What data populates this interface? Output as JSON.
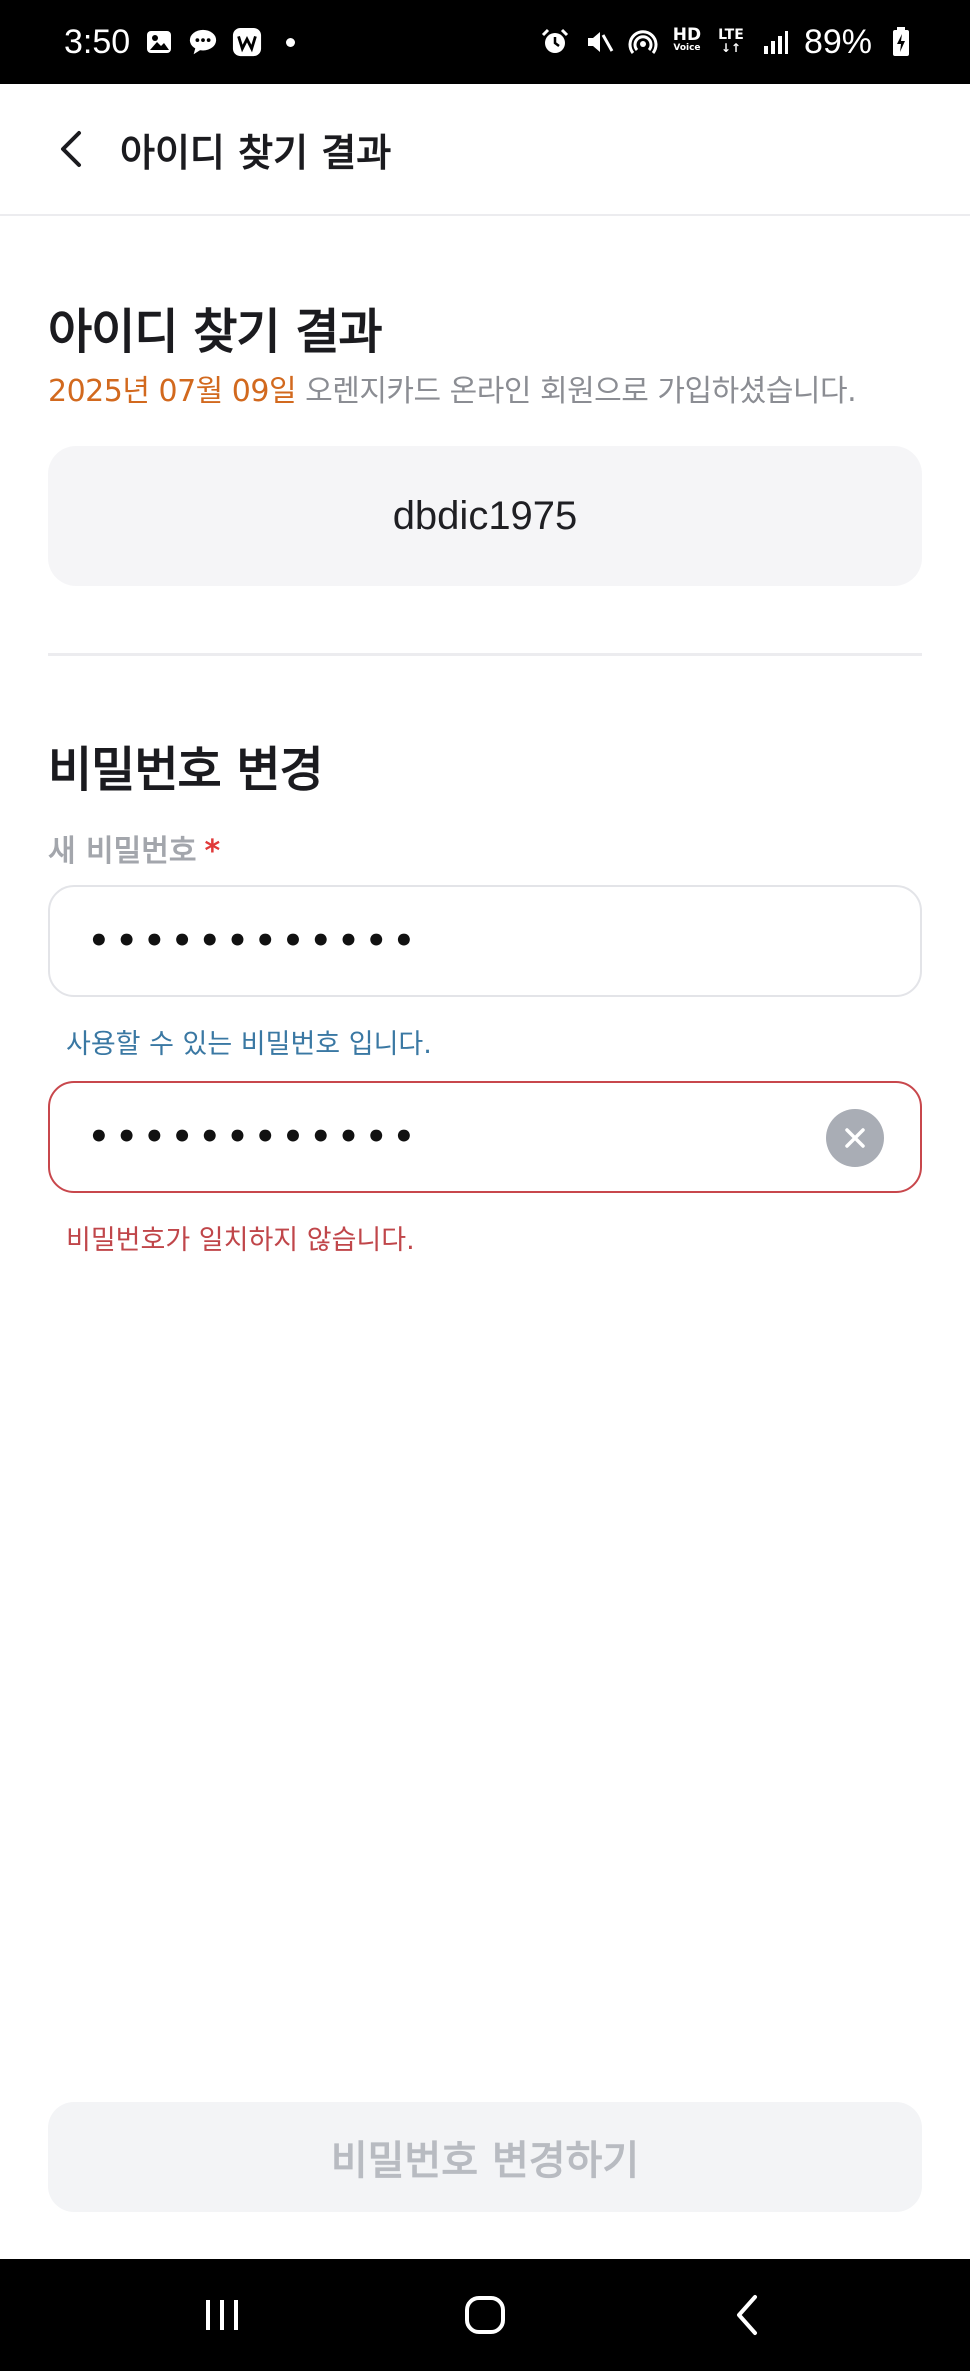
{
  "status_bar": {
    "time": "3:50",
    "battery": "89%",
    "hd_label": "HD",
    "voice_label": "Voice",
    "lte_label": "LTE"
  },
  "app_bar": {
    "title": "아이디 찾기 결과"
  },
  "find_id": {
    "heading": "아이디 찾기 결과",
    "join_date": "2025년 07월 09일",
    "join_message": " 오렌지카드 온라인 회원으로 가입하셨습니다.",
    "user_id": "dbdic1975"
  },
  "password_change": {
    "heading": "비밀번호 변경",
    "new_password_label": "새 비밀번호",
    "required_mark": "*",
    "new_password_value": "••••••••••••",
    "new_password_help": "사용할 수 있는 비밀번호 입니다.",
    "confirm_password_value": "••••••••••••",
    "confirm_password_error": "비밀번호가 일치하지 않습니다."
  },
  "submit_button": {
    "label": "비밀번호 변경하기"
  },
  "colors": {
    "accent_date": "#d2691e",
    "success_help": "#3a78a3",
    "error": "#c0464a",
    "disabled_button_bg": "#f3f4f6",
    "disabled_button_text": "#b8bbc1"
  }
}
